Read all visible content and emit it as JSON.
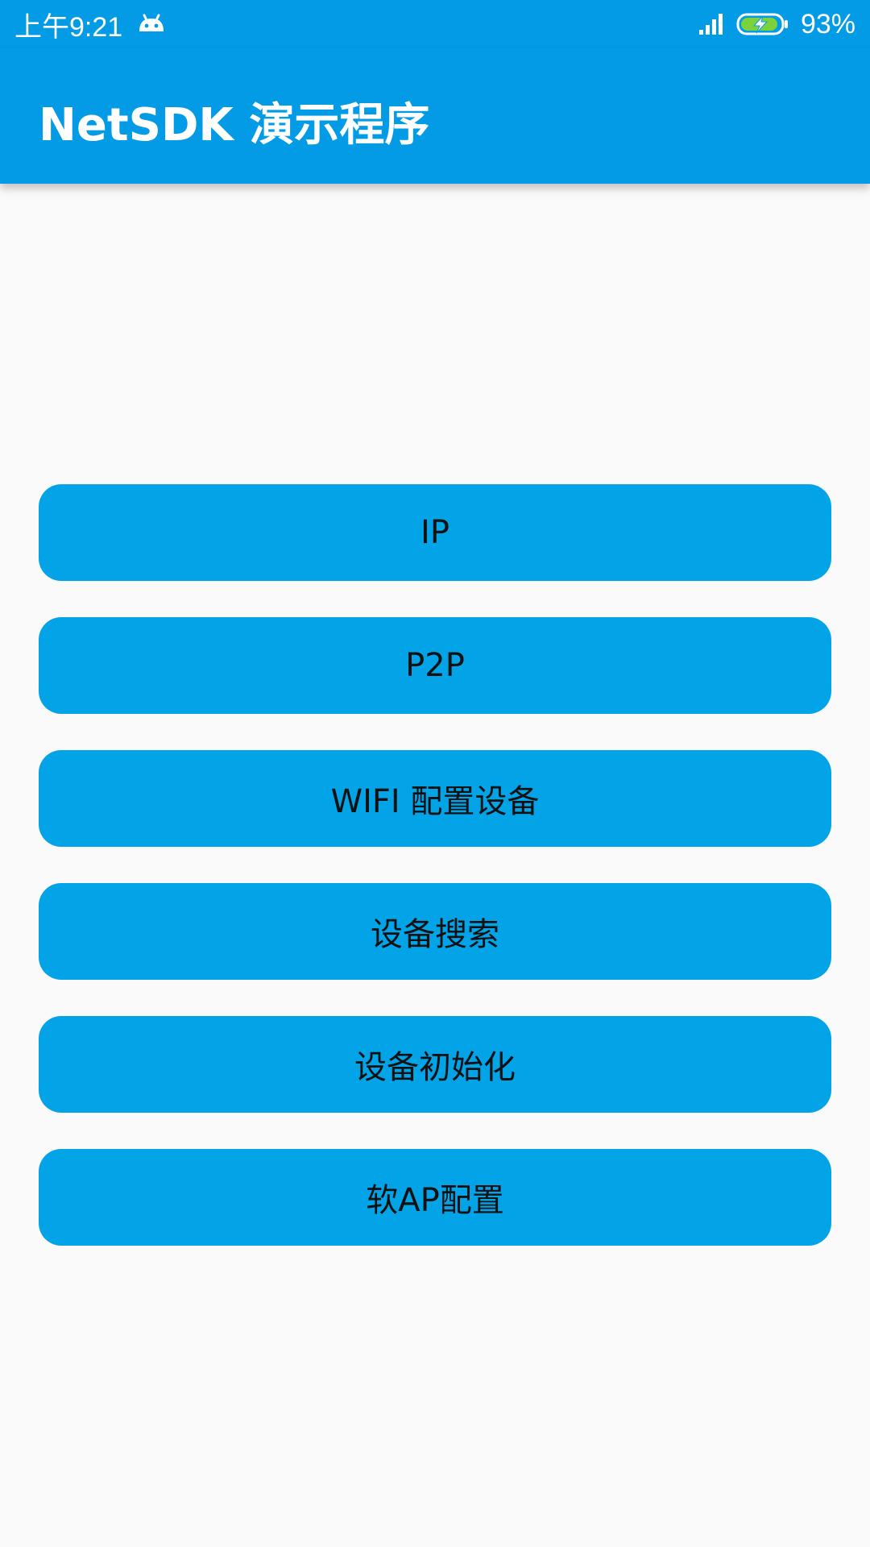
{
  "status_bar": {
    "time": "上午9:21",
    "battery_percent": "93%",
    "icons": [
      "android-notification-icon",
      "signal-icon",
      "battery-charging-icon"
    ]
  },
  "app_bar": {
    "title": "NetSDK 演示程序",
    "background_color": "#039BE5"
  },
  "menu": {
    "buttons": [
      {
        "label": "IP"
      },
      {
        "label": "P2P"
      },
      {
        "label": "WIFI 配置设备"
      },
      {
        "label": "设备搜索"
      },
      {
        "label": "设备初始化"
      },
      {
        "label": "软AP配置"
      }
    ],
    "button_color": "#03A3E8"
  }
}
